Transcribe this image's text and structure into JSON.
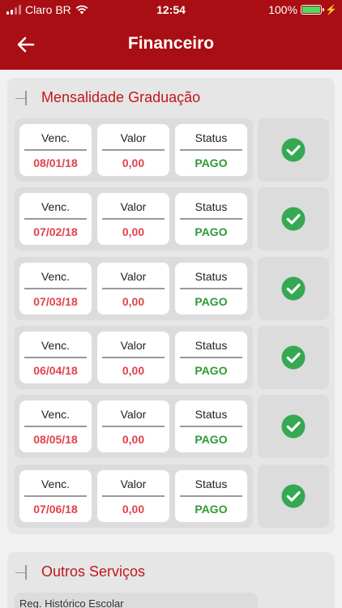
{
  "status_bar": {
    "carrier": "Claro BR",
    "time": "12:54",
    "battery": "100%",
    "battery_level": 1.0
  },
  "navbar": {
    "title": "Financeiro",
    "back_icon": "arrow-left-icon"
  },
  "section_graduacao": {
    "title": "Mensalidade Graduação",
    "col_labels": {
      "venc": "Venc.",
      "valor": "Valor",
      "status": "Status"
    },
    "rows": [
      {
        "venc": "08/01/18",
        "valor": "0,00",
        "status": "PAGO"
      },
      {
        "venc": "07/02/18",
        "valor": "0,00",
        "status": "PAGO"
      },
      {
        "venc": "07/03/18",
        "valor": "0,00",
        "status": "PAGO"
      },
      {
        "venc": "06/04/18",
        "valor": "0,00",
        "status": "PAGO"
      },
      {
        "venc": "08/05/18",
        "valor": "0,00",
        "status": "PAGO"
      },
      {
        "venc": "07/06/18",
        "valor": "0,00",
        "status": "PAGO"
      }
    ],
    "row_icon": "check-circle-icon"
  },
  "section_outros": {
    "title": "Outros Serviços",
    "items": [
      {
        "label": "Reg. Histórico Escolar"
      }
    ]
  },
  "colors": {
    "brand": "#a80e13",
    "accent_text": "#c0171c",
    "date_red": "#e0434b",
    "paid_green": "#2e9b3a",
    "check_green": "#35a853"
  }
}
